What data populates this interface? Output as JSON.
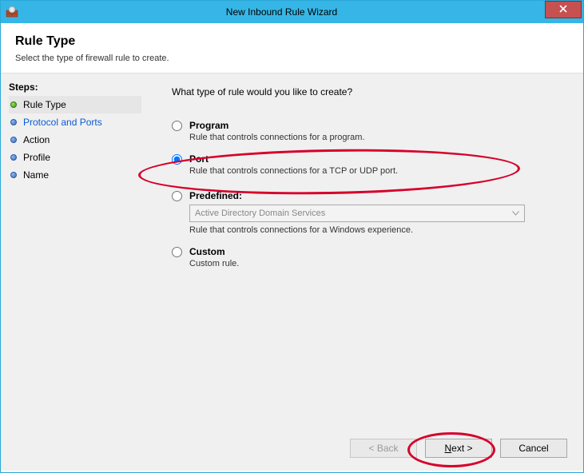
{
  "window": {
    "title": "New Inbound Rule Wizard"
  },
  "header": {
    "title": "Rule Type",
    "subtitle": "Select the type of firewall rule to create."
  },
  "sidebar": {
    "steps_label": "Steps:",
    "items": [
      {
        "label": "Rule Type"
      },
      {
        "label": "Protocol and Ports"
      },
      {
        "label": "Action"
      },
      {
        "label": "Profile"
      },
      {
        "label": "Name"
      }
    ]
  },
  "main": {
    "question": "What type of rule would you like to create?",
    "options": {
      "program": {
        "label": "Program",
        "desc": "Rule that controls connections for a program."
      },
      "port": {
        "label": "Port",
        "desc": "Rule that controls connections for a TCP or UDP port."
      },
      "predefined": {
        "label": "Predefined:",
        "select_value": "Active Directory Domain Services",
        "desc": "Rule that controls connections for a Windows experience."
      },
      "custom": {
        "label": "Custom",
        "desc": "Custom rule."
      }
    },
    "buttons": {
      "back": "< Back",
      "next_prefix": "N",
      "next_rest": "ext >",
      "cancel": "Cancel"
    }
  }
}
